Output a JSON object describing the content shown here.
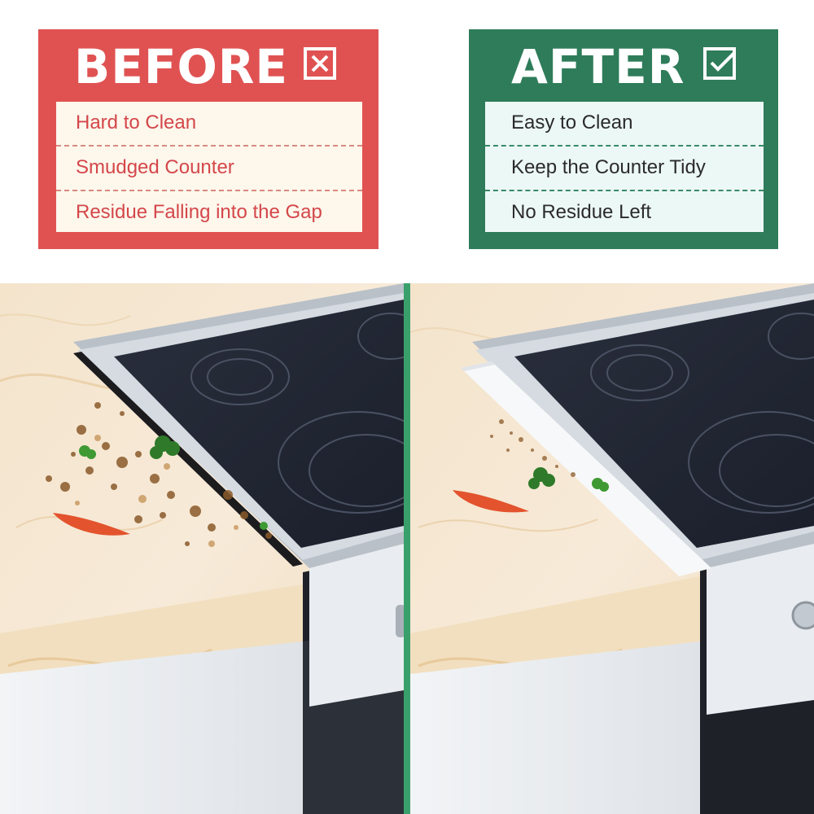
{
  "before": {
    "title": "BEFORE",
    "icon": "x-box-icon",
    "color": "#e05252",
    "items": [
      "Hard to Clean",
      "Smudged Counter",
      "Residue Falling into the Gap"
    ]
  },
  "after": {
    "title": "AFTER",
    "icon": "checkmark-box-icon",
    "color": "#2f7c5a",
    "items": [
      "Easy to Clean",
      "Keep the Counter Tidy",
      "No Residue Left"
    ]
  },
  "divider_color": "#3aa06b"
}
